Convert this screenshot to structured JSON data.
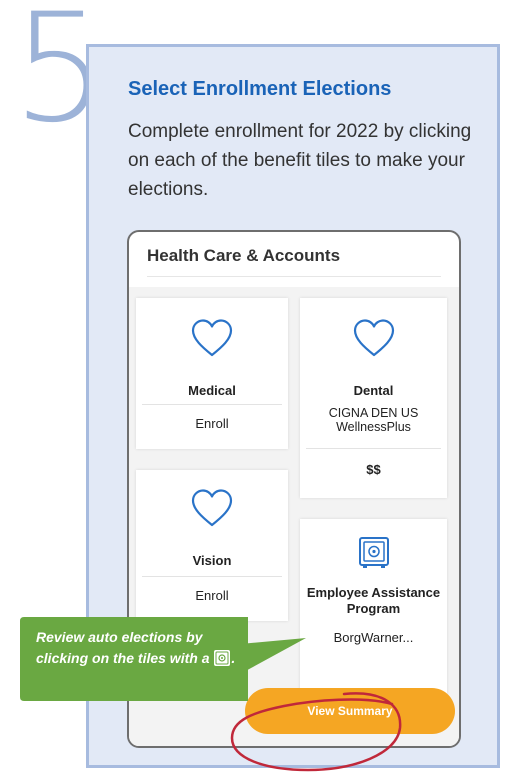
{
  "step": {
    "number": "5"
  },
  "section": {
    "title": "Select Enrollment Elections",
    "description": "Complete enrollment for 2022 by clicking on each of the benefit tiles to make your elections."
  },
  "app": {
    "header": "Health Care & Accounts",
    "tiles": [
      {
        "name": "Medical",
        "status": "Enroll",
        "icon": "heart-icon"
      },
      {
        "name": "Dental",
        "plan": "CIGNA DEN US WellnessPlus",
        "cost": "$$",
        "icon": "heart-icon"
      },
      {
        "name": "Vision",
        "status": "Enroll",
        "icon": "heart-icon"
      },
      {
        "name": "Employee Assistance Program",
        "plan": "BorgWarner...",
        "icon": "safe-icon"
      }
    ],
    "view_summary_label": "View Summary"
  },
  "callout": {
    "text": "Review auto elections by clicking on the tiles with a",
    "suffix": "."
  },
  "colors": {
    "accent_blue": "#1a63b7",
    "panel_bg": "#e2e9f6",
    "button_orange": "#f5a623",
    "callout_green": "#6aa842",
    "highlight_red": "#c0283a"
  }
}
